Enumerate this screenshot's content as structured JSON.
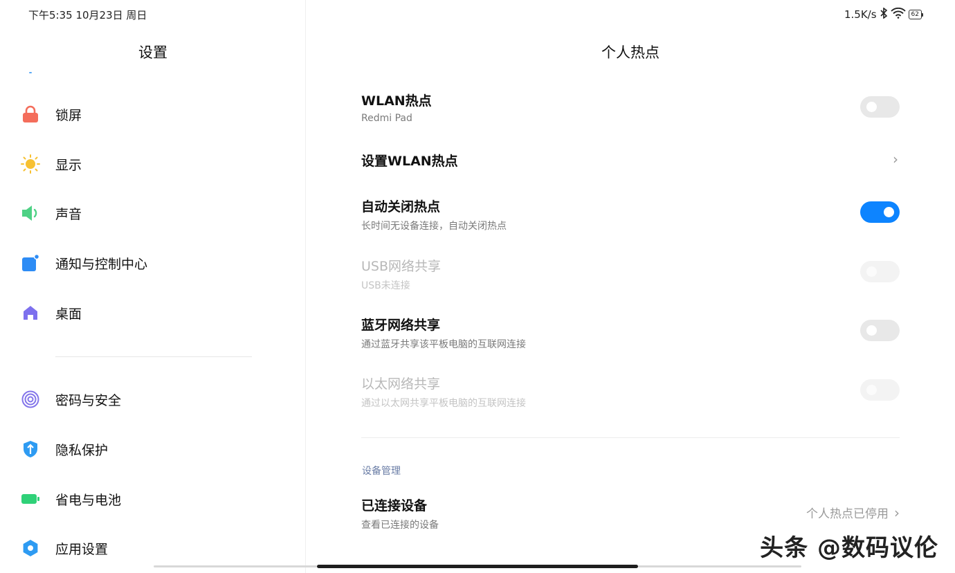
{
  "status_bar": {
    "datetime": "下午5:35 10月23日 周日",
    "net_speed": "1.5K/s",
    "battery": "62"
  },
  "sidebar": {
    "title": "设置",
    "items": [
      {
        "label": "锁屏",
        "icon": "lock-icon",
        "color": "#f46d5b"
      },
      {
        "label": "显示",
        "icon": "sun-icon",
        "color": "#f7c132"
      },
      {
        "label": "声音",
        "icon": "speaker-icon",
        "color": "#4ed185"
      },
      {
        "label": "通知与控制中心",
        "icon": "notification-icon",
        "color": "#2d8cf5"
      },
      {
        "label": "桌面",
        "icon": "home-icon",
        "color": "#7d70ee"
      },
      {
        "label": "密码与安全",
        "icon": "fingerprint-icon",
        "color": "#8375ea"
      },
      {
        "label": "隐私保护",
        "icon": "privacy-shield-icon",
        "color": "#2e9bf2"
      },
      {
        "label": "省电与电池",
        "icon": "battery-icon",
        "color": "#2fd178"
      },
      {
        "label": "应用设置",
        "icon": "gear-icon",
        "color": "#2e9bf2"
      }
    ]
  },
  "main": {
    "title": "个人热点",
    "rows": [
      {
        "title": "WLAN热点",
        "subtitle": "Redmi Pad",
        "control": "toggle",
        "state": "off"
      },
      {
        "title": "设置WLAN热点",
        "control": "chevron"
      },
      {
        "title": "自动关闭热点",
        "subtitle": "长时间无设备连接，自动关闭热点",
        "control": "toggle",
        "state": "on"
      },
      {
        "title": "USB网络共享",
        "subtitle": "USB未连接",
        "control": "toggle",
        "state": "disabled"
      },
      {
        "title": "蓝牙网络共享",
        "subtitle": "通过蓝牙共享该平板电脑的互联网连接",
        "control": "toggle",
        "state": "off"
      },
      {
        "title": "以太网络共享",
        "subtitle": "通过以太网共享平板电脑的互联网连接",
        "control": "toggle",
        "state": "disabled"
      }
    ],
    "section_header": "设备管理",
    "connected_devices": {
      "title": "已连接设备",
      "subtitle": "查看已连接的设备",
      "value": "个人热点已停用"
    }
  },
  "watermark": "头条 @数码议伦",
  "colors": {
    "accent": "#0d84ff"
  }
}
